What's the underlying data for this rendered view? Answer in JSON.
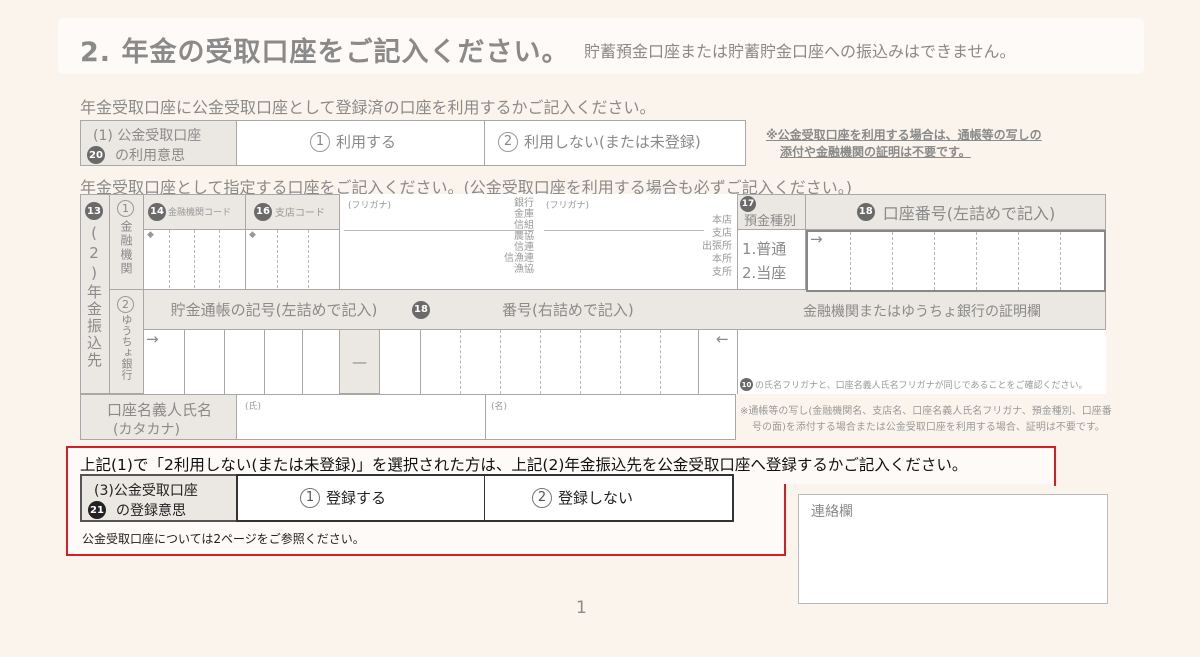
{
  "header": {
    "title": "2. 年金の受取口座をご記入ください。",
    "note": "貯蓄預金口座または貯蓄貯金口座への振込みはできません。"
  },
  "section1": {
    "instruction": "年金受取口座に公金受取口座として登録済の口座を利用するかご記入ください。",
    "label_line1": "(1) 公金受取口座",
    "label_badge": "20",
    "label_line2": "の利用意思",
    "opt1_num": "1",
    "opt1_label": "利用する",
    "opt2_num": "2",
    "opt2_label": "利用しない(または未登録)",
    "note_line1": "※公金受取口座を利用する場合は、通帳等の写しの",
    "note_line2": "添付や金融機関の証明は不要です。"
  },
  "section2": {
    "instruction": "年金受取口座として指定する口座をご記入ください。(公金受取口座を利用する場合も必ずご記入ください。)",
    "badge13": "13",
    "side_label": "(2)年金振込先",
    "row1_num": "1",
    "row1_label": "金融機関",
    "badge14": "14",
    "code14": "金融機関コード",
    "badge16": "16",
    "code16": "支店コード",
    "furigana1": "(フリガナ)",
    "furigana2": "(フリガナ)",
    "bank_types": [
      "銀行",
      "金庫",
      "信組",
      "農協",
      "信連",
      "信漁連",
      "漁協"
    ],
    "branch_types": [
      "本店",
      "支店",
      "出張所",
      "本所",
      "支所"
    ],
    "badge17": "17",
    "deposit_label": "預金種別",
    "deposit_opt1": "1.普通",
    "deposit_opt2": "2.当座",
    "badge18": "18",
    "account_label": "口座番号(左詰めで記入)",
    "arrow_right": "→",
    "row2_num": "2",
    "row2_label": "ゆうちょ銀行",
    "passbook_symbol": "貯金通帳の記号(左詰めで記入)",
    "badge18b": "18",
    "passbook_number": "番号(右詰めで記入)",
    "arrow_left": "←",
    "dash": "—",
    "cert_label": "金融機関またはゆうちょ銀行の証明欄",
    "badge10": "10",
    "cert_note": "の氏名フリガナと、口座名義人氏名フリガナが同じであることをご確認ください。",
    "holder_line1": "口座名義人氏名",
    "holder_line2": "(カタカナ)",
    "surname": "(氏)",
    "given": "(名)",
    "holder_note_line1": "※通帳等の写し(金融機関名、支店名、口座名義人氏名フリガナ、預金種別、口座番",
    "holder_note_line2": "号の面)を添付する場合または公金受取口座を利用する場合、証明は不要です。"
  },
  "section3": {
    "instruction": "上記(1)で「2利用しない(または未登録)」を選択された方は、上記(2)年金振込先を公金受取口座へ登録するかご記入ください。",
    "label_line1": "(3)公金受取口座",
    "label_badge": "21",
    "label_line2": "の登録意思",
    "opt1_num": "1",
    "opt1_label": "登録する",
    "opt2_num": "2",
    "opt2_label": "登録しない",
    "footnote": "公金受取口座については2ページをご参照ください。"
  },
  "contact": {
    "label": "連絡欄"
  },
  "page_number": "1"
}
